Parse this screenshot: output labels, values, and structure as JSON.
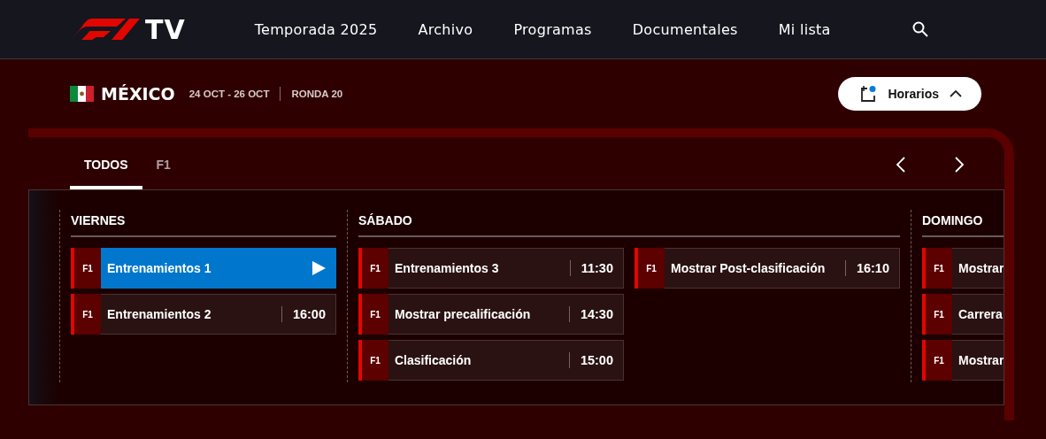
{
  "header": {
    "logo_text": "TV",
    "nav": [
      {
        "label": "Temporada 2025"
      },
      {
        "label": "Archivo"
      },
      {
        "label": "Programas"
      },
      {
        "label": "Documentales"
      },
      {
        "label": "Mi lista"
      }
    ]
  },
  "event": {
    "country": "MÉXICO",
    "dates": "24 OCT - 26 OCT",
    "round": "RONDA 20",
    "schedule_button": {
      "label": "Horarios",
      "expanded": true
    }
  },
  "tabs": [
    {
      "label": "TODOS",
      "selected": true
    },
    {
      "label": "F1",
      "selected": false
    }
  ],
  "days": [
    {
      "name": "VIERNES",
      "columns": [
        [
          {
            "series": "F1",
            "title": "Entrenamientos 1",
            "live": true
          },
          {
            "series": "F1",
            "title": "Entrenamientos 2",
            "time": "16:00",
            "live": false
          }
        ]
      ]
    },
    {
      "name": "SÁBADO",
      "columns": [
        [
          {
            "series": "F1",
            "title": "Entrenamientos 3",
            "time": "11:30",
            "live": false
          },
          {
            "series": "F1",
            "title": "Mostrar precalificación",
            "time": "14:30",
            "live": false
          },
          {
            "series": "F1",
            "title": "Clasificación",
            "time": "15:00",
            "live": false
          }
        ],
        [
          {
            "series": "F1",
            "title": "Mostrar Post-clasificación",
            "time": "16:10",
            "live": false
          }
        ]
      ]
    },
    {
      "name": "DOMINGO",
      "columns": [
        [
          {
            "series": "F1",
            "title": "Mostrar",
            "live": false
          },
          {
            "series": "F1",
            "title": "Carrera",
            "live": false
          },
          {
            "series": "F1",
            "title": "Mostrar",
            "live": false
          }
        ]
      ]
    }
  ]
}
